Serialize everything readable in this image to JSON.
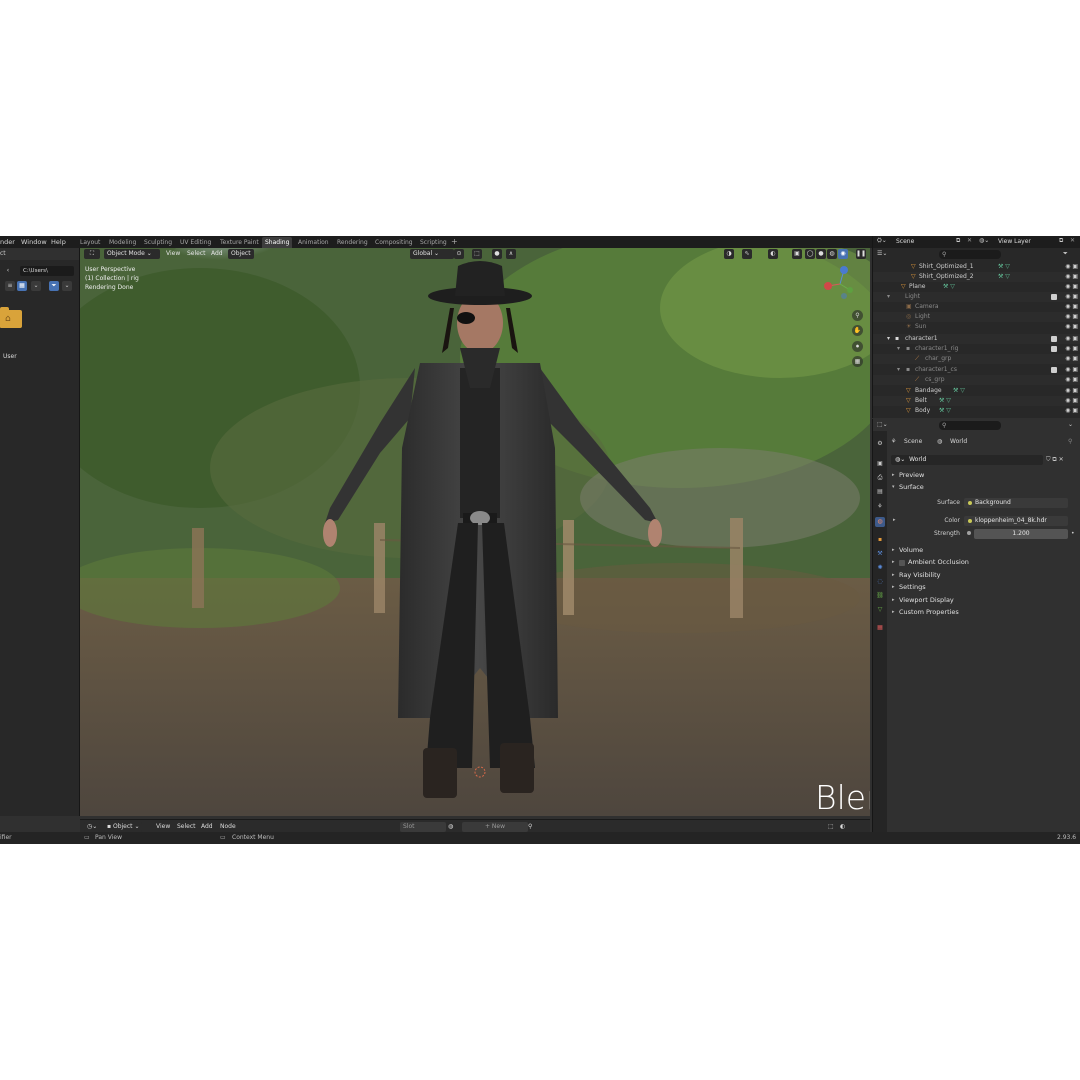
{
  "menu": {
    "items": [
      "nder",
      "Window",
      "Help"
    ]
  },
  "workspaces": [
    "Layout",
    "Modeling",
    "Sculpting",
    "UV Editing",
    "Texture Paint",
    "Shading",
    "Animation",
    "Rendering",
    "Compositing",
    "Scripting"
  ],
  "active_workspace": "Shading",
  "add_workspace": "+",
  "left_panel": {
    "label": "ct",
    "path": "C:\\Users\\",
    "folder_label": "User"
  },
  "viewport": {
    "mode": "Object Mode",
    "menus": [
      "View",
      "Select",
      "Add",
      "Object"
    ],
    "orientation": "Global",
    "overlay_lines": [
      "User Perspective",
      "(1) Collection | rig",
      "Rendering Done"
    ],
    "caption": "Blender scene"
  },
  "node_editor": {
    "mode": "Object",
    "menus": [
      "View",
      "Select",
      "Add",
      "Node"
    ],
    "slot": "Slot",
    "new": "New"
  },
  "status": {
    "left": "ifier",
    "pan": "Pan View",
    "context": "Context Menu",
    "version": "2.93.6"
  },
  "outliner": {
    "scene": "Scene",
    "view_layer": "View Layer",
    "rows": [
      {
        "label": "Shirt_Optimized_1",
        "indent": 3,
        "icon": "triangle-icon"
      },
      {
        "label": "Shirt_Optimized_2",
        "indent": 3,
        "icon": "triangle-icon"
      },
      {
        "label": "Plane",
        "indent": 2,
        "icon": "triangle-icon"
      },
      {
        "label": "Light",
        "indent": 1,
        "icon": "collection-icon"
      },
      {
        "label": "Camera",
        "indent": 2,
        "icon": "camera-icon"
      },
      {
        "label": "Light",
        "indent": 2,
        "icon": "light-icon"
      },
      {
        "label": "Sun",
        "indent": 2,
        "icon": "sun-icon"
      },
      {
        "label": "character1",
        "indent": 1,
        "icon": "collection-icon"
      },
      {
        "label": "character1_rig",
        "indent": 2,
        "icon": "collection-icon"
      },
      {
        "label": "char_grp",
        "indent": 3,
        "icon": "armature-icon"
      },
      {
        "label": "character1_cs",
        "indent": 2,
        "icon": "collection-icon"
      },
      {
        "label": "cs_grp",
        "indent": 3,
        "icon": "armature-icon"
      },
      {
        "label": "Bandage",
        "indent": 2,
        "icon": "triangle-icon"
      },
      {
        "label": "Belt",
        "indent": 2,
        "icon": "triangle-icon"
      },
      {
        "label": "Body",
        "indent": 2,
        "icon": "triangle-icon"
      }
    ]
  },
  "properties": {
    "breadcrumb_scene": "Scene",
    "breadcrumb_world": "World",
    "world_name": "World",
    "panels": {
      "preview": "Preview",
      "surface": "Surface",
      "volume": "Volume",
      "ambient_occlusion": "Ambient Occlusion",
      "ray_visibility": "Ray Visibility",
      "settings": "Settings",
      "viewport_display": "Viewport Display",
      "custom_properties": "Custom Properties"
    },
    "surface_label": "Surface",
    "surface_value": "Background",
    "color_label": "Color",
    "color_value": "kloppenheim_04_8k.hdr",
    "strength_label": "Strength",
    "strength_value": "1.200"
  },
  "colors": {
    "accent": "#4772b3",
    "object_orange": "#e39a3b",
    "mesh_green": "#63c39a"
  }
}
